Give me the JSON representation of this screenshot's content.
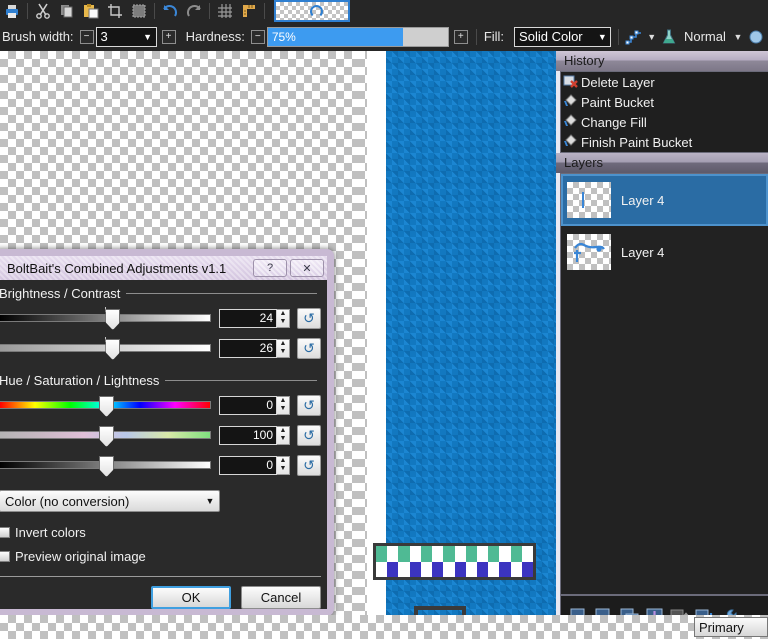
{
  "app": {
    "toolbar_icons": [
      "print-icon",
      "cut-icon",
      "copy-icon",
      "paste-icon",
      "crop-to-selection-icon",
      "deselect-icon",
      "undo-icon",
      "redo-icon",
      "grid-icon",
      "ruler-icon"
    ],
    "thumbnail_name": "document-thumbnail"
  },
  "options_bar": {
    "brush_width_label": "Brush width:",
    "brush_width_value": "3",
    "brush_width_decrease": "−",
    "brush_width_increase": "+",
    "hardness_label": "Hardness:",
    "hardness_value": "75%",
    "hardness_percent": 75,
    "hardness_decrease": "−",
    "hardness_increase": "+",
    "fill_label": "Fill:",
    "fill_value": "Solid Color",
    "blend_mode_value": "Normal",
    "antialias_icon": "antialiasing-curve-icon",
    "blend_icon": "blending-flask-icon",
    "dropdown_arrow": "▼"
  },
  "history": {
    "title": "History",
    "items": [
      {
        "label": "Delete Layer",
        "icon": "delete-layer-icon"
      },
      {
        "label": "Paint Bucket",
        "icon": "paint-bucket-icon"
      },
      {
        "label": "Change Fill",
        "icon": "paint-bucket-icon"
      },
      {
        "label": "Finish Paint Bucket",
        "icon": "paint-bucket-icon"
      }
    ]
  },
  "layers": {
    "title": "Layers",
    "items": [
      {
        "label": "Layer 4",
        "selected": true
      },
      {
        "label": "Layer 4",
        "selected": false
      }
    ],
    "toolbar": [
      {
        "name": "add-layer-button"
      },
      {
        "name": "delete-layer-button"
      },
      {
        "name": "duplicate-layer-button"
      },
      {
        "name": "merge-layer-down-button"
      },
      {
        "name": "move-layer-up-button"
      },
      {
        "name": "move-layer-down-button"
      },
      {
        "name": "layer-properties-button"
      }
    ]
  },
  "dialog": {
    "title": "BoltBait's Combined Adjustments v1.1",
    "help_label": "?",
    "close_label": "✕",
    "group1_title": "Brightness / Contrast",
    "group2_title": "Hue / Saturation / Lightness",
    "sliders": [
      {
        "name": "brightness",
        "value": "24",
        "pos": 53,
        "tick": 50
      },
      {
        "name": "contrast",
        "value": "26",
        "pos": 53,
        "tick": 50
      },
      {
        "name": "hue",
        "value": "0",
        "pos": 50,
        "tick": -1
      },
      {
        "name": "saturation",
        "value": "100",
        "pos": 50,
        "tick": -1
      },
      {
        "name": "lightness",
        "value": "0",
        "pos": 50,
        "tick": -1
      }
    ],
    "reset_glyph": "↺",
    "spin_up": "▲",
    "spin_down": "▼",
    "conversion_value": "Color (no conversion)",
    "conversion_arrow": "▼",
    "invert_colors_label": "Invert colors",
    "preview_original_label": "Preview original image",
    "ok_label": "OK",
    "cancel_label": "Cancel"
  },
  "statusbar": {
    "primary_label": "Primary"
  },
  "colors": {
    "accent_blue": "#3d9bf0",
    "selection_blue": "#2a6ca4",
    "canvas_blue": "#1278c0",
    "dialog_chrome": "#d6c6e2",
    "panel_dark": "#1f1f1f"
  },
  "pattern_band": {
    "top_row": [
      "#4fba94",
      "#ffffff",
      "#4fba94",
      "#ffffff",
      "#4fba94",
      "#ffffff",
      "#4fba94",
      "#ffffff",
      "#4fba94",
      "#ffffff",
      "#4fba94",
      "#ffffff",
      "#4fba94",
      "#ffffff"
    ],
    "bottom_row": [
      "#ffffff",
      "#3b34c0",
      "#ffffff",
      "#3b34c0",
      "#ffffff",
      "#3b34c0",
      "#ffffff",
      "#3b34c0",
      "#ffffff",
      "#3b34c0",
      "#ffffff",
      "#3b34c0",
      "#ffffff",
      "#3b34c0"
    ]
  }
}
